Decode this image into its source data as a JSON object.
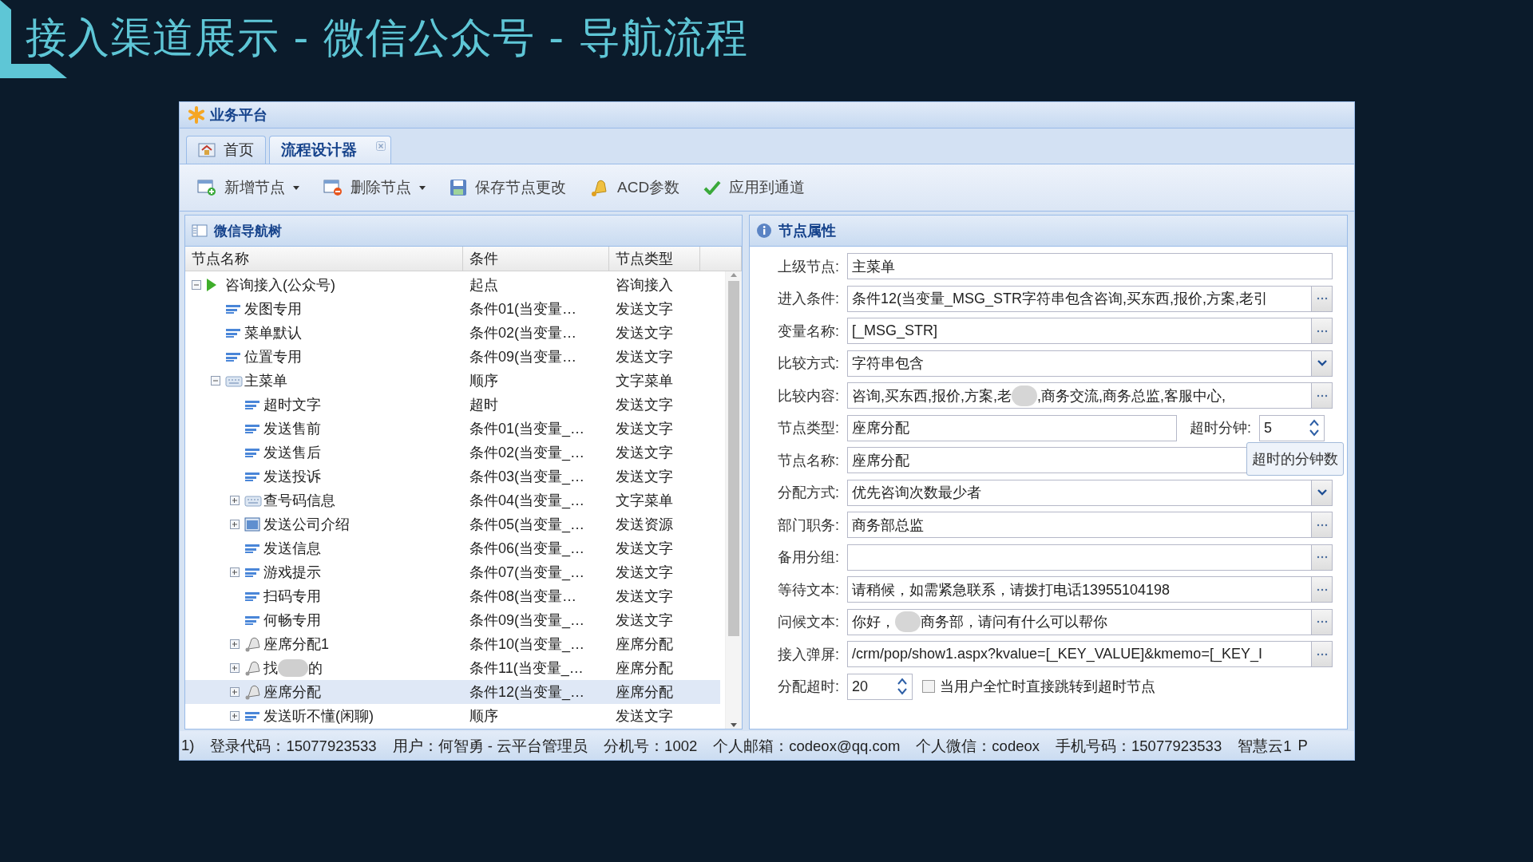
{
  "slide": {
    "title": "接入渠道展示 - 微信公众号 - 导航流程"
  },
  "window": {
    "title": "业务平台"
  },
  "tabs": [
    {
      "label": "首页",
      "kind": "home",
      "selected": false,
      "closable": false
    },
    {
      "label": "流程设计器",
      "kind": "plain",
      "selected": true,
      "closable": true
    }
  ],
  "toolbar": [
    {
      "label": "新增节点",
      "kind": "add",
      "menu": true
    },
    {
      "label": "删除节点",
      "kind": "delete",
      "menu": true
    },
    {
      "label": "保存节点更改",
      "kind": "save",
      "menu": false
    },
    {
      "label": "ACD参数",
      "kind": "bell",
      "menu": false
    },
    {
      "label": "应用到通道",
      "kind": "check",
      "menu": false
    }
  ],
  "tree": {
    "title": "微信导航树",
    "columns": [
      "节点名称",
      "条件",
      "节点类型"
    ],
    "rows": [
      {
        "name": "咨询接入(公众号)",
        "condition": "起点",
        "type": "咨询接入",
        "kind": "start",
        "selected": false,
        "expanded": true,
        "children": [
          {
            "name": "发图专用",
            "condition": "条件01(当变量…",
            "type": "发送文字",
            "kind": "text",
            "selected": false
          },
          {
            "name": "菜单默认",
            "condition": "条件02(当变量…",
            "type": "发送文字",
            "kind": "text",
            "selected": false
          },
          {
            "name": "位置专用",
            "condition": "条件09(当变量…",
            "type": "发送文字",
            "kind": "text",
            "selected": false
          },
          {
            "name": "主菜单",
            "condition": "顺序",
            "type": "文字菜单",
            "kind": "menu",
            "selected": false,
            "expanded": true,
            "children": [
              {
                "name": "超时文字",
                "condition": "超时",
                "type": "发送文字",
                "kind": "text",
                "selected": false
              },
              {
                "name": "发送售前",
                "condition": "条件01(当变量_…",
                "type": "发送文字",
                "kind": "text",
                "selected": false
              },
              {
                "name": "发送售后",
                "condition": "条件02(当变量_…",
                "type": "发送文字",
                "kind": "text",
                "selected": false
              },
              {
                "name": "发送投诉",
                "condition": "条件03(当变量_…",
                "type": "发送文字",
                "kind": "text",
                "selected": false
              },
              {
                "name": "查号码信息",
                "condition": "条件04(当变量_…",
                "type": "文字菜单",
                "kind": "menu",
                "selected": false,
                "expanded": false
              },
              {
                "name": "发送公司介绍",
                "condition": "条件05(当变量_…",
                "type": "发送资源",
                "kind": "resource",
                "selected": false,
                "expanded": false
              },
              {
                "name": "发送信息",
                "condition": "条件06(当变量_…",
                "type": "发送文字",
                "kind": "text",
                "selected": false
              },
              {
                "name": "游戏提示",
                "condition": "条件07(当变量_…",
                "type": "发送文字",
                "kind": "text",
                "selected": false,
                "expanded": false
              },
              {
                "name": "扫码专用",
                "condition": "条件08(当变量…",
                "type": "发送文字",
                "kind": "text",
                "selected": false
              },
              {
                "name": "何畅专用",
                "condition": "条件09(当变量_…",
                "type": "发送文字",
                "kind": "text",
                "selected": false
              },
              {
                "name": "座席分配1",
                "condition": "条件10(当变量_…",
                "type": "座席分配",
                "kind": "seat",
                "selected": false,
                "expanded": false
              },
              {
                "name": "找",
                "name_after": "的",
                "condition": "条件11(当变量_…",
                "type": "座席分配",
                "kind": "seat",
                "selected": false,
                "expanded": false
              },
              {
                "name": "座席分配",
                "condition": "条件12(当变量_…",
                "type": "座席分配",
                "kind": "seat",
                "selected": true,
                "expanded": false
              },
              {
                "name": "发送听不懂(闲聊)",
                "condition": "顺序",
                "type": "发送文字",
                "kind": "text",
                "selected": false,
                "expanded": false
              }
            ]
          }
        ]
      }
    ]
  },
  "properties": {
    "title": "节点属性",
    "rows": [
      {
        "label": "上级节点:",
        "kind": "text",
        "value": "主菜单"
      },
      {
        "label": "进入条件:",
        "kind": "picker",
        "value": "条件12(当变量_MSG_STR字符串包含咨询,买东西,报价,方案,老引"
      },
      {
        "label": "变量名称:",
        "kind": "picker",
        "value": "[_MSG_STR]"
      },
      {
        "label": "比较方式:",
        "kind": "select",
        "value": "字符串包含"
      },
      {
        "label": "比较内容:",
        "kind": "picker",
        "value": "咨询,买东西,报价,方案,老",
        "value_after": ",商务交流,商务总监,客服中心,"
      },
      {
        "label": "节点类型:",
        "kind": "text_spinner",
        "value": "座席分配",
        "extra_label": "超时分钟:",
        "extra_value": "5"
      },
      {
        "label": "节点名称:",
        "kind": "text",
        "value": "座席分配",
        "tooltip": "超时的分钟数"
      },
      {
        "label": "分配方式:",
        "kind": "select",
        "value": "优先咨询次数最少者"
      },
      {
        "label": "部门职务:",
        "kind": "picker",
        "value": "商务部总监"
      },
      {
        "label": "备用分组:",
        "kind": "picker"
      },
      {
        "label": "等待文本:",
        "kind": "picker",
        "value": "请稍候，如需紧急联系，请拨打电话13955104198"
      },
      {
        "label": "问候文本:",
        "kind": "picker",
        "value": "你好，",
        "value_after": "商务部，请问有什么可以帮你"
      },
      {
        "label": "接入弹屏:",
        "kind": "picker",
        "value": "/crm/pop/show1.aspx?kvalue=[_KEY_VALUE]&kmemo=[_KEY_I"
      },
      {
        "label": "分配超时:",
        "kind": "spinner_check",
        "value": "20",
        "checkbox": {
          "label": "当用户全忙时直接跳转到超时节点",
          "checked": false
        }
      }
    ]
  },
  "status_bar": [
    "1)",
    "登录代码：15077923533",
    "用户：何智勇 - 云平台管理员",
    "分机号：1002",
    "个人邮箱：codeox@qq.com",
    "个人微信：codeox",
    "手机号码：15077923533",
    "智慧云1",
    "P"
  ]
}
